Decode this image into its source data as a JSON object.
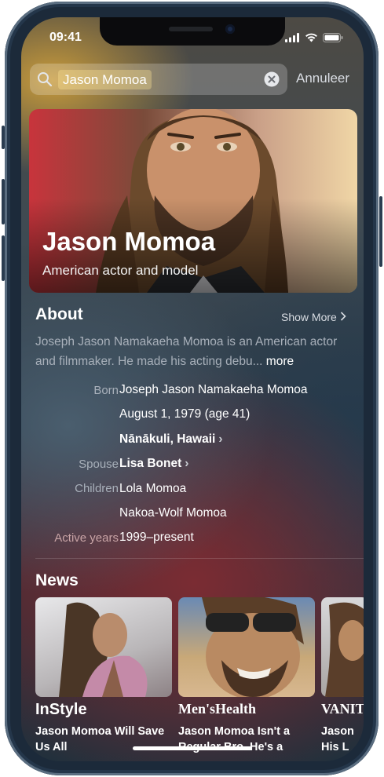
{
  "status_bar": {
    "time": "09:41"
  },
  "search": {
    "query": "Jason Momoa",
    "cancel_label": "Annuleer"
  },
  "hero": {
    "name": "Jason Momoa",
    "subtitle": "American actor and model"
  },
  "about": {
    "title": "About",
    "show_more_label": "Show More",
    "description": "Joseph Jason Namakaeha Momoa is an American actor and filmmaker. He made his acting debu...",
    "more_label": "more",
    "born_label": "Born",
    "born_name": "Joseph Jason Namakaeha Momoa",
    "born_date": "August 1, 1979 (age 41)",
    "born_place": "Nānākuli, Hawaii",
    "spouse_label": "Spouse",
    "spouse": "Lisa Bonet",
    "children_label": "Children",
    "child_1": "Lola Momoa",
    "child_2": "Nakoa-Wolf Momoa",
    "active_label": "Active years",
    "active_years": "1999–present"
  },
  "news": {
    "title": "News",
    "items": [
      {
        "source": "InStyle",
        "headline": "Jason Momoa Will Save Us All"
      },
      {
        "source": "Men'sHealth",
        "headline": "Jason Momoa Isn't a Regular Bro. He's a"
      },
      {
        "source": "VANITY FA",
        "headline": "Jason His L"
      }
    ]
  }
}
